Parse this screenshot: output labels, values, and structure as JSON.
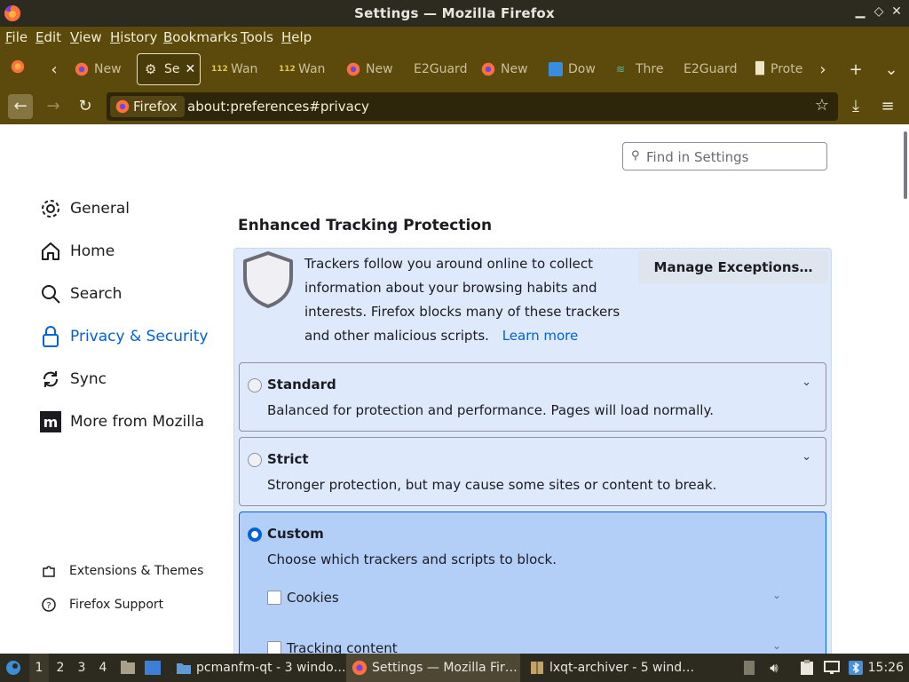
{
  "window": {
    "title": "Settings — Mozilla Firefox"
  },
  "menubar": {
    "items": [
      {
        "key": "F",
        "rest": "ile"
      },
      {
        "key": "E",
        "rest": "dit"
      },
      {
        "key": "V",
        "rest": "iew"
      },
      {
        "key": "H",
        "rest": "istory"
      },
      {
        "key": "B",
        "rest": "ookmarks"
      },
      {
        "key": "T",
        "rest": "ools"
      },
      {
        "key": "H",
        "rest": "elp"
      }
    ]
  },
  "tabs": [
    {
      "label": "New",
      "icon": "firefox-icon"
    },
    {
      "label": "Se",
      "icon": "gear-icon",
      "active": true
    },
    {
      "label": "Wan",
      "icon": "112-icon"
    },
    {
      "label": "Wan",
      "icon": "112-icon"
    },
    {
      "label": "New",
      "icon": "firefox-icon"
    },
    {
      "label": "E2Guard",
      "icon": "none"
    },
    {
      "label": "New",
      "icon": "firefox-icon"
    },
    {
      "label": "Dow",
      "icon": "download-site-icon"
    },
    {
      "label": "Thre",
      "icon": "threads-icon"
    },
    {
      "label": "E2Guard",
      "icon": "none"
    },
    {
      "label": "Prote",
      "icon": "chart-icon"
    }
  ],
  "navbar": {
    "identity_label": "Firefox",
    "url": "about:preferences#privacy"
  },
  "search": {
    "placeholder": "Find in Settings"
  },
  "sidebar": {
    "items": [
      {
        "label": "General",
        "icon": "gear-icon"
      },
      {
        "label": "Home",
        "icon": "home-icon"
      },
      {
        "label": "Search",
        "icon": "search-icon"
      },
      {
        "label": "Privacy & Security",
        "icon": "lock-icon",
        "selected": true
      },
      {
        "label": "Sync",
        "icon": "sync-icon"
      },
      {
        "label": "More from Mozilla",
        "icon": "mozilla-icon"
      }
    ],
    "footer": [
      {
        "label": "Extensions & Themes",
        "icon": "puzzle-icon"
      },
      {
        "label": "Firefox Support",
        "icon": "help-icon"
      }
    ]
  },
  "etp": {
    "title": "Enhanced Tracking Protection",
    "description": "Trackers follow you around online to collect information about your browsing habits and interests. Firefox blocks many of these trackers and other malicious scripts.",
    "learn_more": "Learn more",
    "manage_exceptions": "Manage Exceptions…",
    "options": [
      {
        "name": "Standard",
        "desc": "Balanced for protection and performance. Pages will load normally.",
        "selected": false
      },
      {
        "name": "Strict",
        "desc": "Stronger protection, but may cause some sites or content to break.",
        "selected": false
      },
      {
        "name": "Custom",
        "desc": "Choose which trackers and scripts to block.",
        "selected": true
      }
    ],
    "custom_checks": [
      {
        "label": "Cookies",
        "checked": false
      },
      {
        "label": "Tracking content",
        "checked": false
      }
    ]
  },
  "taskbar": {
    "workspaces": [
      "1",
      "2",
      "3",
      "4"
    ],
    "current_workspace": "1",
    "tasks": [
      {
        "label": "pcmanfm-qt - 3 windo…",
        "icon": "folder-icon"
      },
      {
        "label": "Settings — Mozilla Fir…",
        "icon": "firefox-icon",
        "active": true
      },
      {
        "label": "lxqt-archiver - 5 wind…",
        "icon": "archive-icon"
      }
    ],
    "clock": "15:26"
  },
  "colors": {
    "chrome": "#5b4a0c",
    "titlebar": "#2d2a1f",
    "accent": "#0061e0",
    "panel": "#deeafc",
    "selected_option": "#b3cff7"
  }
}
